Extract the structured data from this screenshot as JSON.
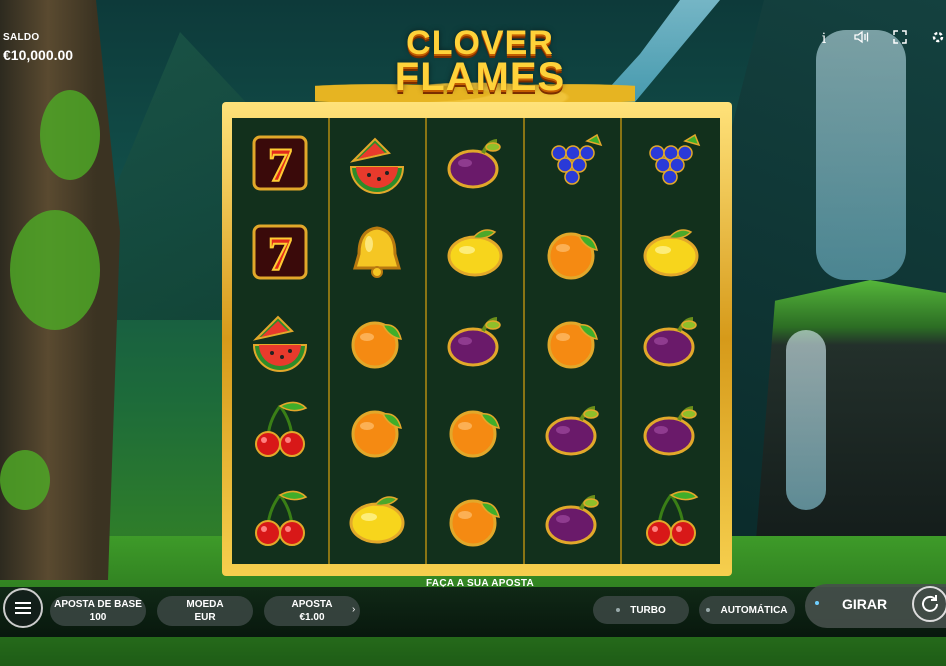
{
  "balance": {
    "label": "SALDO",
    "value": "€10,000.00"
  },
  "top_icons": [
    "info-icon",
    "sound-icon",
    "fullscreen-icon",
    "settings-icon"
  ],
  "logo": {
    "line1": "CLOVER",
    "line2": "FLAMES"
  },
  "reels": [
    [
      "seven",
      "watermelon",
      "plum",
      "grapes",
      "grapes"
    ],
    [
      "seven",
      "bell",
      "lemon",
      "orange",
      "lemon"
    ],
    [
      "watermelon",
      "orange",
      "plum",
      "orange",
      "plum"
    ],
    [
      "cherries",
      "orange",
      "orange",
      "plum",
      "plum"
    ],
    [
      "cherries",
      "lemon",
      "orange",
      "plum",
      "cherries"
    ]
  ],
  "status_text": "FAÇA A SUA APOSTA",
  "controls": {
    "base_bet": {
      "label": "APOSTA DE BASE",
      "value": "100"
    },
    "coin": {
      "label": "MOEDA",
      "value": "EUR"
    },
    "bet": {
      "label": "APOSTA",
      "value": "€1.00"
    },
    "turbo": "TURBO",
    "auto": "AUTOMÁTICA",
    "spin": "GIRAR"
  }
}
